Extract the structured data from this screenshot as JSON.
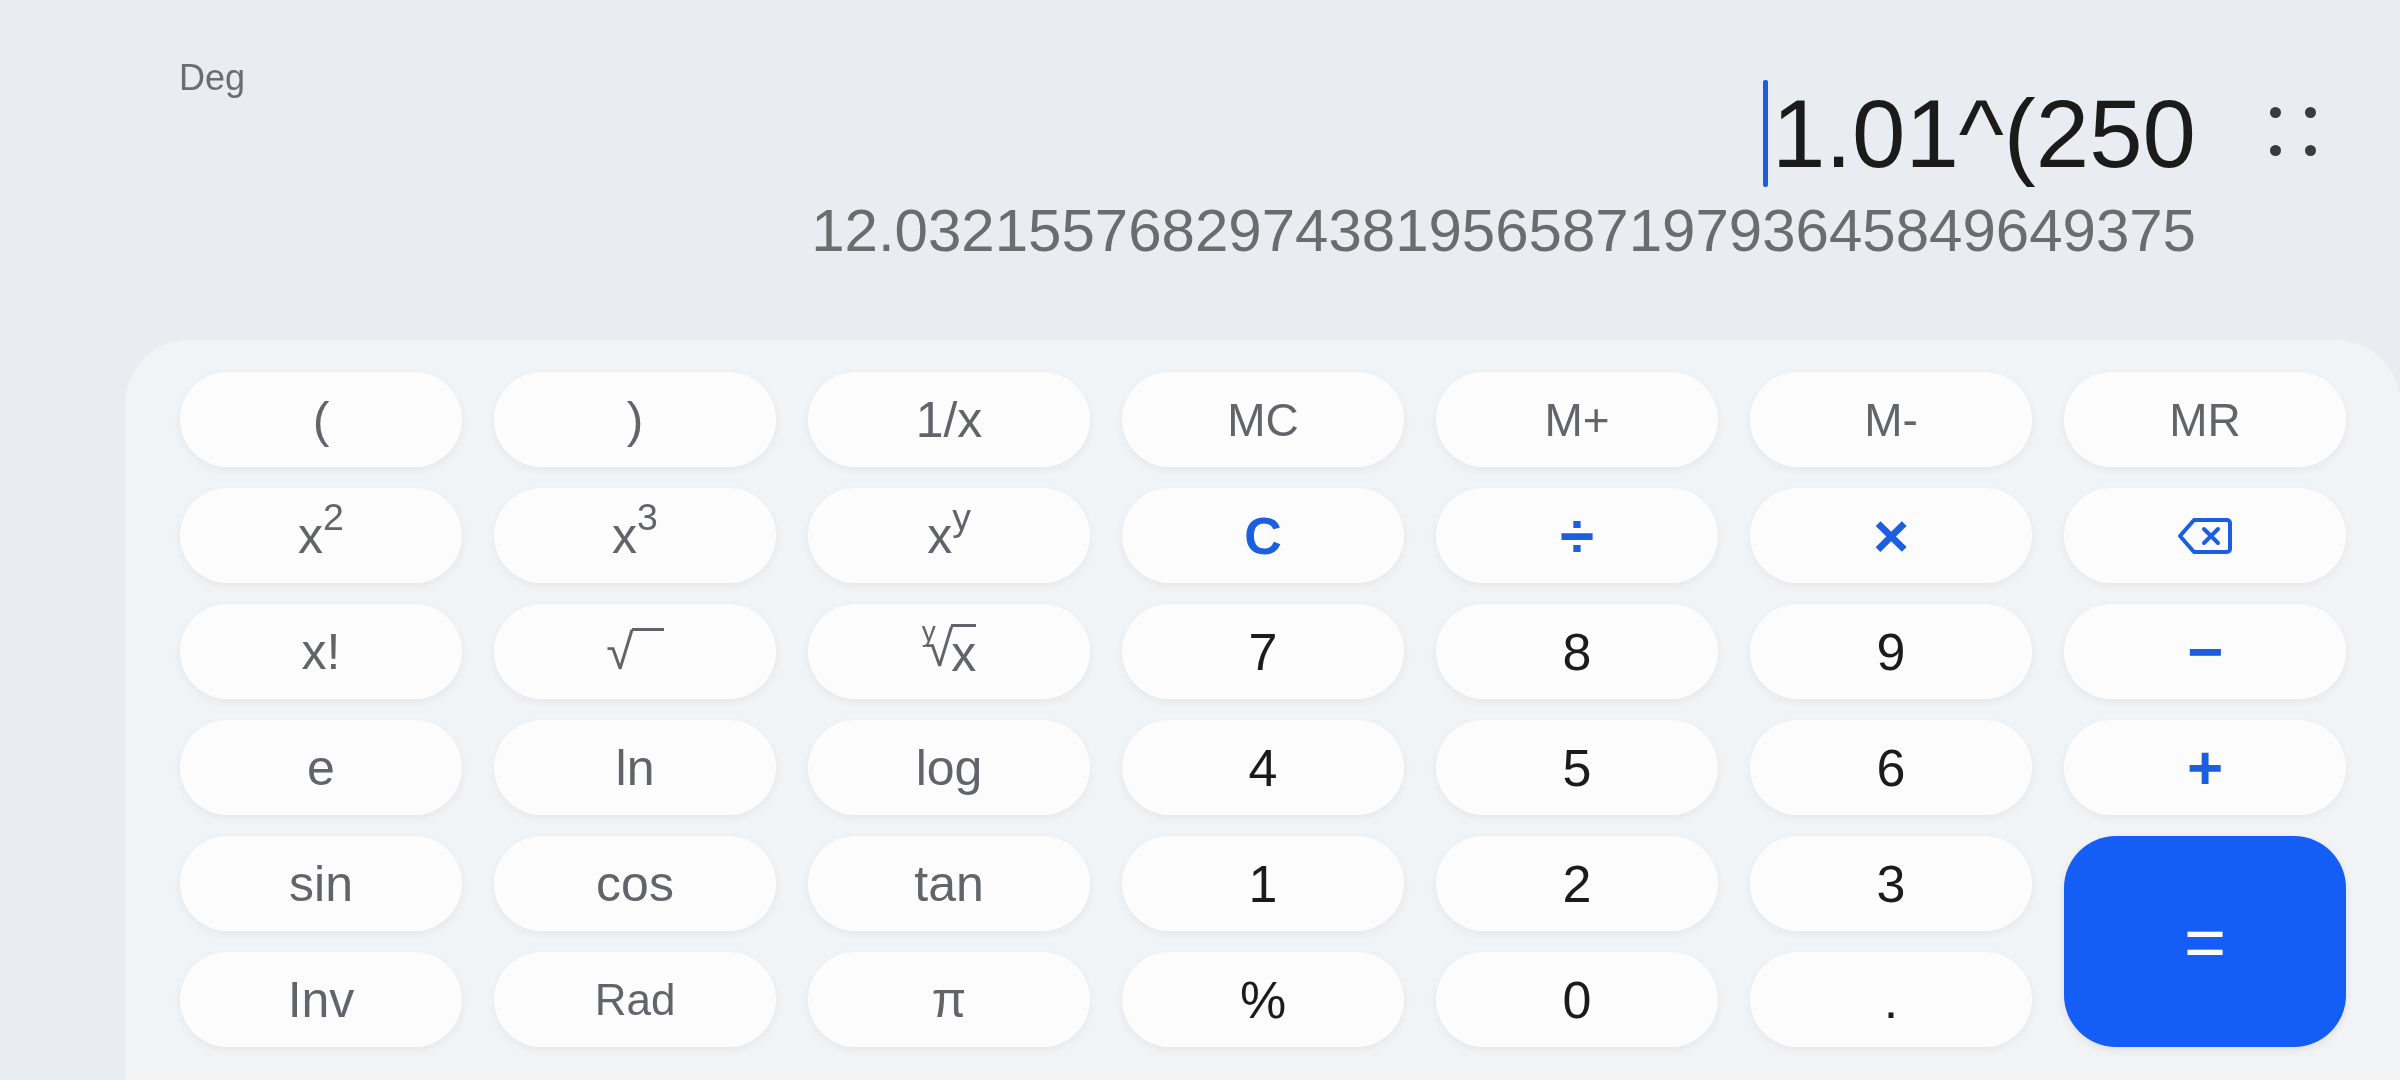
{
  "angle_mode": "Deg",
  "display": {
    "expression": "1.01^(250",
    "result": "12.032155768297438195658719793645849649375"
  },
  "keypad": {
    "rows": [
      [
        {
          "kind": "function",
          "label": "("
        },
        {
          "kind": "function",
          "label": ")"
        },
        {
          "kind": "function",
          "label": "1/x"
        },
        {
          "kind": "memory",
          "label": "MC"
        },
        {
          "kind": "memory",
          "label": "M+"
        },
        {
          "kind": "memory",
          "label": "M-"
        },
        {
          "kind": "memory",
          "label": "MR"
        }
      ],
      [
        {
          "kind": "function",
          "label": "x$^{2}$"
        },
        {
          "kind": "function",
          "label": "x$^{3}$"
        },
        {
          "kind": "function",
          "label": "x$^{y}$"
        },
        {
          "kind": "clear",
          "label": "C"
        },
        {
          "kind": "operator",
          "label": "÷"
        },
        {
          "kind": "operator",
          "label": "×"
        },
        {
          "kind": "backspace"
        }
      ],
      [
        {
          "kind": "function",
          "label": "x!"
        },
        {
          "kind": "root",
          "label": "√"
        },
        {
          "kind": "root",
          "index": "y",
          "label": "√",
          "radicand": "x"
        },
        {
          "kind": "digit",
          "label": "7"
        },
        {
          "kind": "digit",
          "label": "8"
        },
        {
          "kind": "digit",
          "label": "9"
        },
        {
          "kind": "operator",
          "label": "−"
        }
      ],
      [
        {
          "kind": "function",
          "label": "e"
        },
        {
          "kind": "function",
          "label": "ln"
        },
        {
          "kind": "function",
          "label": "log"
        },
        {
          "kind": "digit",
          "label": "4"
        },
        {
          "kind": "digit",
          "label": "5"
        },
        {
          "kind": "digit",
          "label": "6"
        },
        {
          "kind": "operator",
          "label": "+"
        }
      ],
      [
        {
          "kind": "function",
          "label": "sin"
        },
        {
          "kind": "function",
          "label": "cos"
        },
        {
          "kind": "function",
          "label": "tan"
        },
        {
          "kind": "digit",
          "label": "1"
        },
        {
          "kind": "digit",
          "label": "2"
        },
        {
          "kind": "digit",
          "label": "3"
        },
        {
          "kind": "equals",
          "label": "="
        }
      ],
      [
        {
          "kind": "function",
          "label": "Inv"
        },
        {
          "kind": "mode",
          "label": "Rad"
        },
        {
          "kind": "function",
          "label": "π"
        },
        {
          "kind": "digit",
          "label": "%"
        },
        {
          "kind": "digit",
          "label": "0"
        },
        {
          "kind": "digit",
          "label": "."
        }
      ]
    ]
  }
}
